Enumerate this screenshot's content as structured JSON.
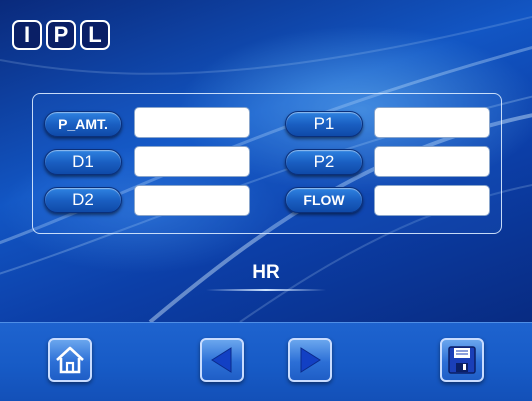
{
  "logo": {
    "letters": [
      "I",
      "P",
      "L"
    ]
  },
  "parameters": {
    "left": [
      {
        "label": "P_AMT.",
        "value": ""
      },
      {
        "label": "D1",
        "value": ""
      },
      {
        "label": "D2",
        "value": ""
      }
    ],
    "right": [
      {
        "label": "P1",
        "value": ""
      },
      {
        "label": "P2",
        "value": ""
      },
      {
        "label": "FLOW",
        "value": ""
      }
    ]
  },
  "mode": {
    "label": "HR"
  },
  "nav": {
    "home_icon": "home-icon",
    "prev_icon": "arrow-left-icon",
    "next_icon": "arrow-right-icon",
    "save_icon": "floppy-disk-icon"
  },
  "colors": {
    "background": "#0c3fa8",
    "button": "#1a5fc2",
    "field": "#ffffff",
    "arrow": "#1240c4"
  }
}
